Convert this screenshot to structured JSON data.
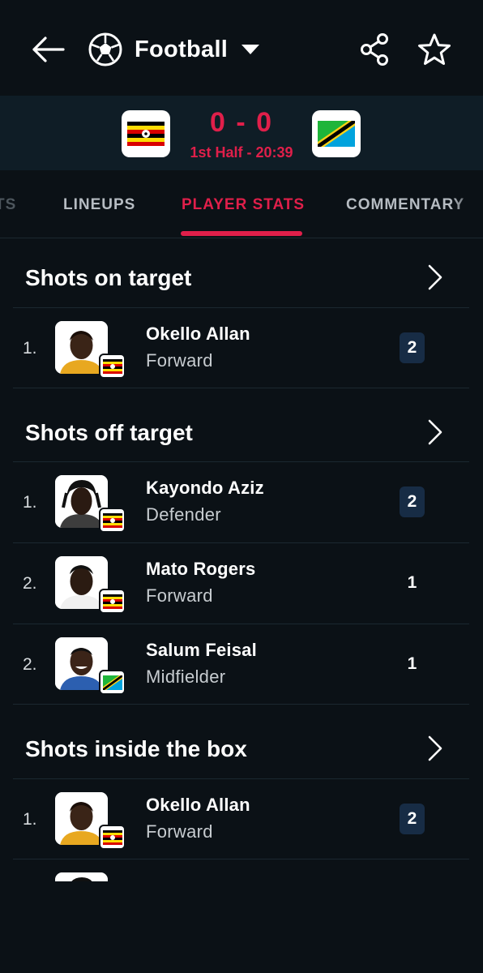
{
  "header": {
    "sport_label": "Football",
    "back_icon": "arrow-left-icon",
    "share_icon": "share-icon",
    "favorite_icon": "star-outline-icon"
  },
  "match": {
    "home_team_flag": "uganda-flag",
    "away_team_flag": "tanzania-flag",
    "score": "0 - 0",
    "status": "1st Half - 20:39"
  },
  "tabs": [
    "TS",
    "LINEUPS",
    "PLAYER STATS",
    "COMMENTARY"
  ],
  "active_tab": "PLAYER STATS",
  "sections": [
    {
      "title": "Shots on target",
      "rows": [
        {
          "rank": "1.",
          "name": "Okello Allan",
          "position": "Forward",
          "value": "2",
          "flag": "uganda",
          "highlight": true
        }
      ]
    },
    {
      "title": "Shots off target",
      "rows": [
        {
          "rank": "1.",
          "name": "Kayondo Aziz",
          "position": "Defender",
          "value": "2",
          "flag": "uganda",
          "highlight": true
        },
        {
          "rank": "2.",
          "name": "Mato Rogers",
          "position": "Forward",
          "value": "1",
          "flag": "uganda",
          "highlight": false
        },
        {
          "rank": "2.",
          "name": "Salum Feisal",
          "position": "Midfielder",
          "value": "1",
          "flag": "tanzania",
          "highlight": false
        }
      ]
    },
    {
      "title": "Shots inside the box",
      "rows": [
        {
          "rank": "1.",
          "name": "Okello Allan",
          "position": "Forward",
          "value": "2",
          "flag": "uganda",
          "highlight": true
        }
      ]
    }
  ],
  "colors": {
    "accent": "#e01f4a",
    "background": "#0b1116",
    "score_bar": "#0f1d26",
    "value_highlight": "#172c45"
  }
}
